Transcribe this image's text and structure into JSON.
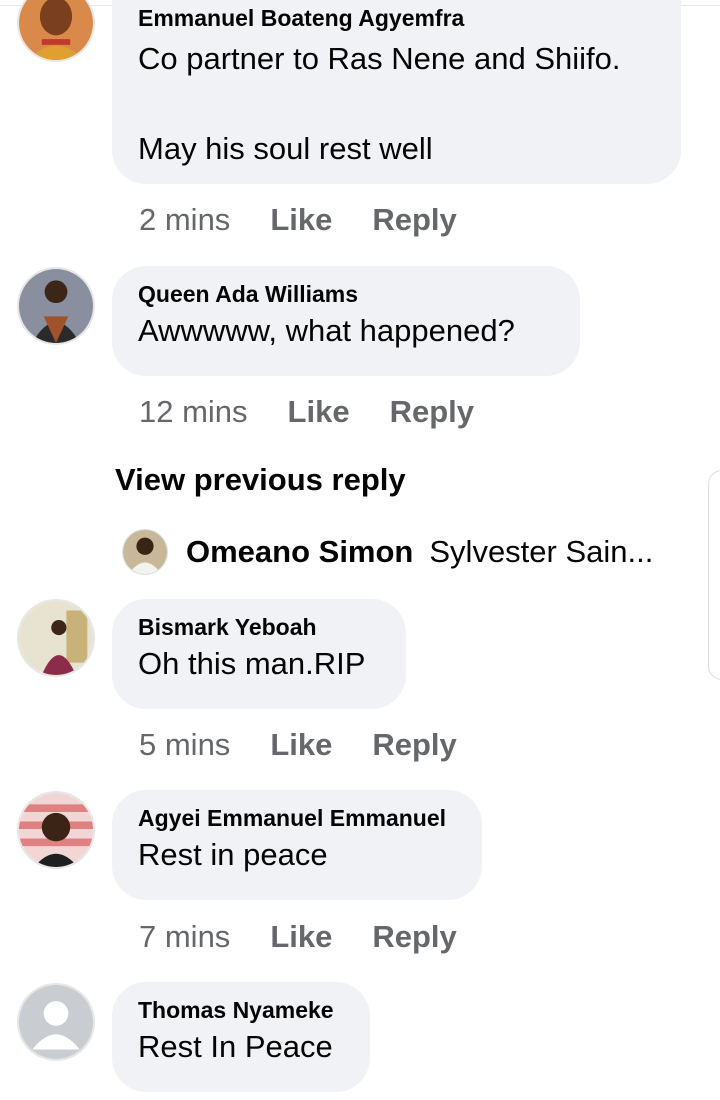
{
  "comments": [
    {
      "name": "Emmanuel Boateng Agyemfra",
      "text": "Co partner to Ras Nene and Shiifo.\n\nMay his soul rest well",
      "time": "2 mins",
      "like": "Like",
      "reply": "Reply"
    },
    {
      "name": "Queen Ada Williams",
      "text": "Awwwww, what happened?",
      "time": "12 mins",
      "like": "Like",
      "reply": "Reply"
    },
    {
      "name": "Bismark Yeboah",
      "text": "Oh this man.RIP",
      "time": "5 mins",
      "like": "Like",
      "reply": "Reply"
    },
    {
      "name": "Agyei Emmanuel Emmanuel",
      "text": "Rest in peace",
      "time": "7 mins",
      "like": "Like",
      "reply": "Reply"
    },
    {
      "name": "Thomas Nyameke",
      "text": "Rest In Peace"
    }
  ],
  "view_previous": "View previous reply",
  "reply_preview": {
    "name": "Omeano Simon",
    "text": "Sylvester Sain..."
  },
  "colors": {
    "bubble": "#f0f2f5",
    "meta_text": "#65676b",
    "primary_text": "#050505"
  }
}
